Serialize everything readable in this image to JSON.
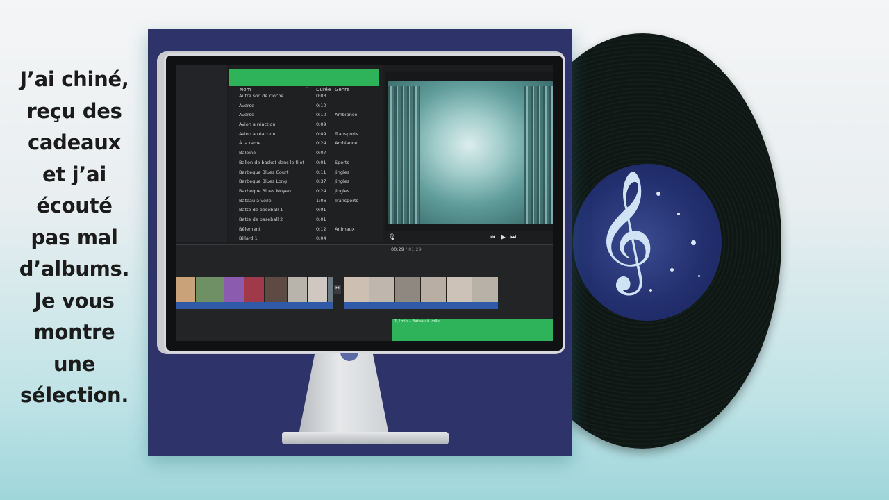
{
  "caption": {
    "lines": [
      "J’ai chiné,",
      "reçu des",
      "cadeaux",
      "et j’ai",
      "écouté",
      "pas mal",
      "d’albums.",
      "Je vous",
      "montre",
      "une",
      "sélection."
    ]
  },
  "browser": {
    "columns": {
      "name": "Nom",
      "duration": "Durée",
      "genre": "Genre"
    },
    "rows": [
      {
        "name": "Autre son de cloche",
        "duration": "0:03",
        "genre": ""
      },
      {
        "name": "Averse",
        "duration": "0:10",
        "genre": ""
      },
      {
        "name": "Averse",
        "duration": "0:10",
        "genre": "Ambiance"
      },
      {
        "name": "Avion à réaction",
        "duration": "0:09",
        "genre": ""
      },
      {
        "name": "Avion à réaction",
        "duration": "0:09",
        "genre": "Transports"
      },
      {
        "name": "À la rame",
        "duration": "0:24",
        "genre": "Ambiance"
      },
      {
        "name": "Baleine",
        "duration": "0:07",
        "genre": ""
      },
      {
        "name": "Ballon de basket dans le filet",
        "duration": "0:01",
        "genre": "Sports"
      },
      {
        "name": "Barbeque Blues Court",
        "duration": "0:11",
        "genre": "Jingles"
      },
      {
        "name": "Barbeque Blues Long",
        "duration": "0:37",
        "genre": "Jingles"
      },
      {
        "name": "Barbeque Blues Moyen",
        "duration": "0:24",
        "genre": "Jingles"
      },
      {
        "name": "Bateau à voile",
        "duration": "1:06",
        "genre": "Transports"
      },
      {
        "name": "Batte de baseball 1",
        "duration": "0:01",
        "genre": ""
      },
      {
        "name": "Batte de baseball 2",
        "duration": "0:01",
        "genre": ""
      },
      {
        "name": "Bêlement",
        "duration": "0:12",
        "genre": "Animaux"
      },
      {
        "name": "Billard 1",
        "duration": "0:04",
        "genre": ""
      }
    ]
  },
  "viewer": {
    "mic_icon": "microphone-icon",
    "controls": [
      "skip-back-icon",
      "play-icon",
      "skip-forward-icon"
    ]
  },
  "timeline": {
    "current_time": "00:29",
    "separator": "/",
    "total_time": "01:29",
    "audio_clip_label": "1,1min – Bateau à voile"
  },
  "colors": {
    "sleeve": "#2e346a",
    "accent_green": "#2eb35a",
    "clip_blue": "#2e5aa8"
  }
}
